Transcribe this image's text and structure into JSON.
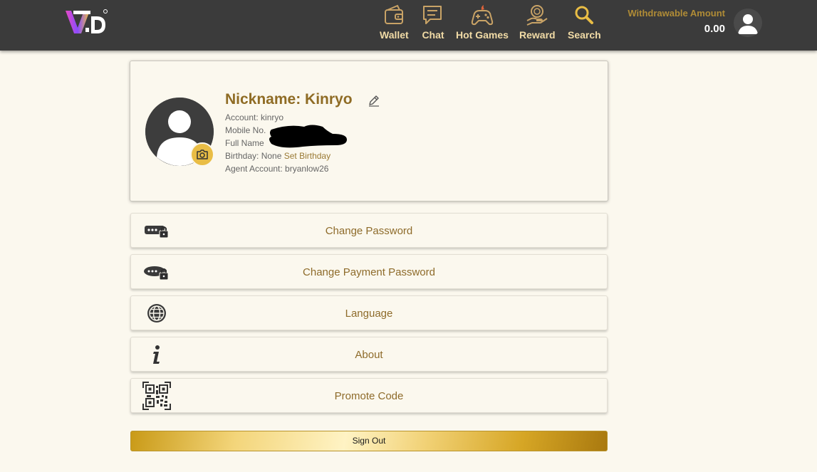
{
  "header": {
    "logo_text": "V.D",
    "nav": [
      {
        "label": "Wallet",
        "icon": "wallet-icon"
      },
      {
        "label": "Chat",
        "icon": "chat-icon"
      },
      {
        "label": "Hot Games",
        "icon": "gamepad-icon"
      },
      {
        "label": "Reward",
        "icon": "reward-icon"
      },
      {
        "label": "Search",
        "icon": "search-icon"
      }
    ],
    "withdrawable_label": "Withdrawable Amount",
    "withdrawable_amount": "0.00",
    "avatar_icon": "user-avatar-icon"
  },
  "profile": {
    "nickname": "Nickname: Kinryo",
    "account": "Account: kinryo",
    "mobile_label": "Mobile No.",
    "full_name_label": "Full Name",
    "birthday_label": "Birthday: None",
    "set_birthday": "Set Birthday",
    "agent_account": "Agent Account: bryanlow26"
  },
  "menu": [
    {
      "label": "Change Password",
      "icon": "password-lock-icon"
    },
    {
      "label": "Change Payment Password",
      "icon": "payment-lock-icon"
    },
    {
      "label": "Language",
      "icon": "globe-icon"
    },
    {
      "label": "About",
      "icon": "info-icon"
    },
    {
      "label": "Promote Code",
      "icon": "qr-code-icon"
    }
  ],
  "sign_out": "Sign Out",
  "colors": {
    "topbar": "#3b3b3b",
    "gold_text": "#8e6b2a",
    "nav_text": "#f1dba6",
    "page_bg": "#fbf8ee",
    "accent_gold": "#e9bd45"
  }
}
